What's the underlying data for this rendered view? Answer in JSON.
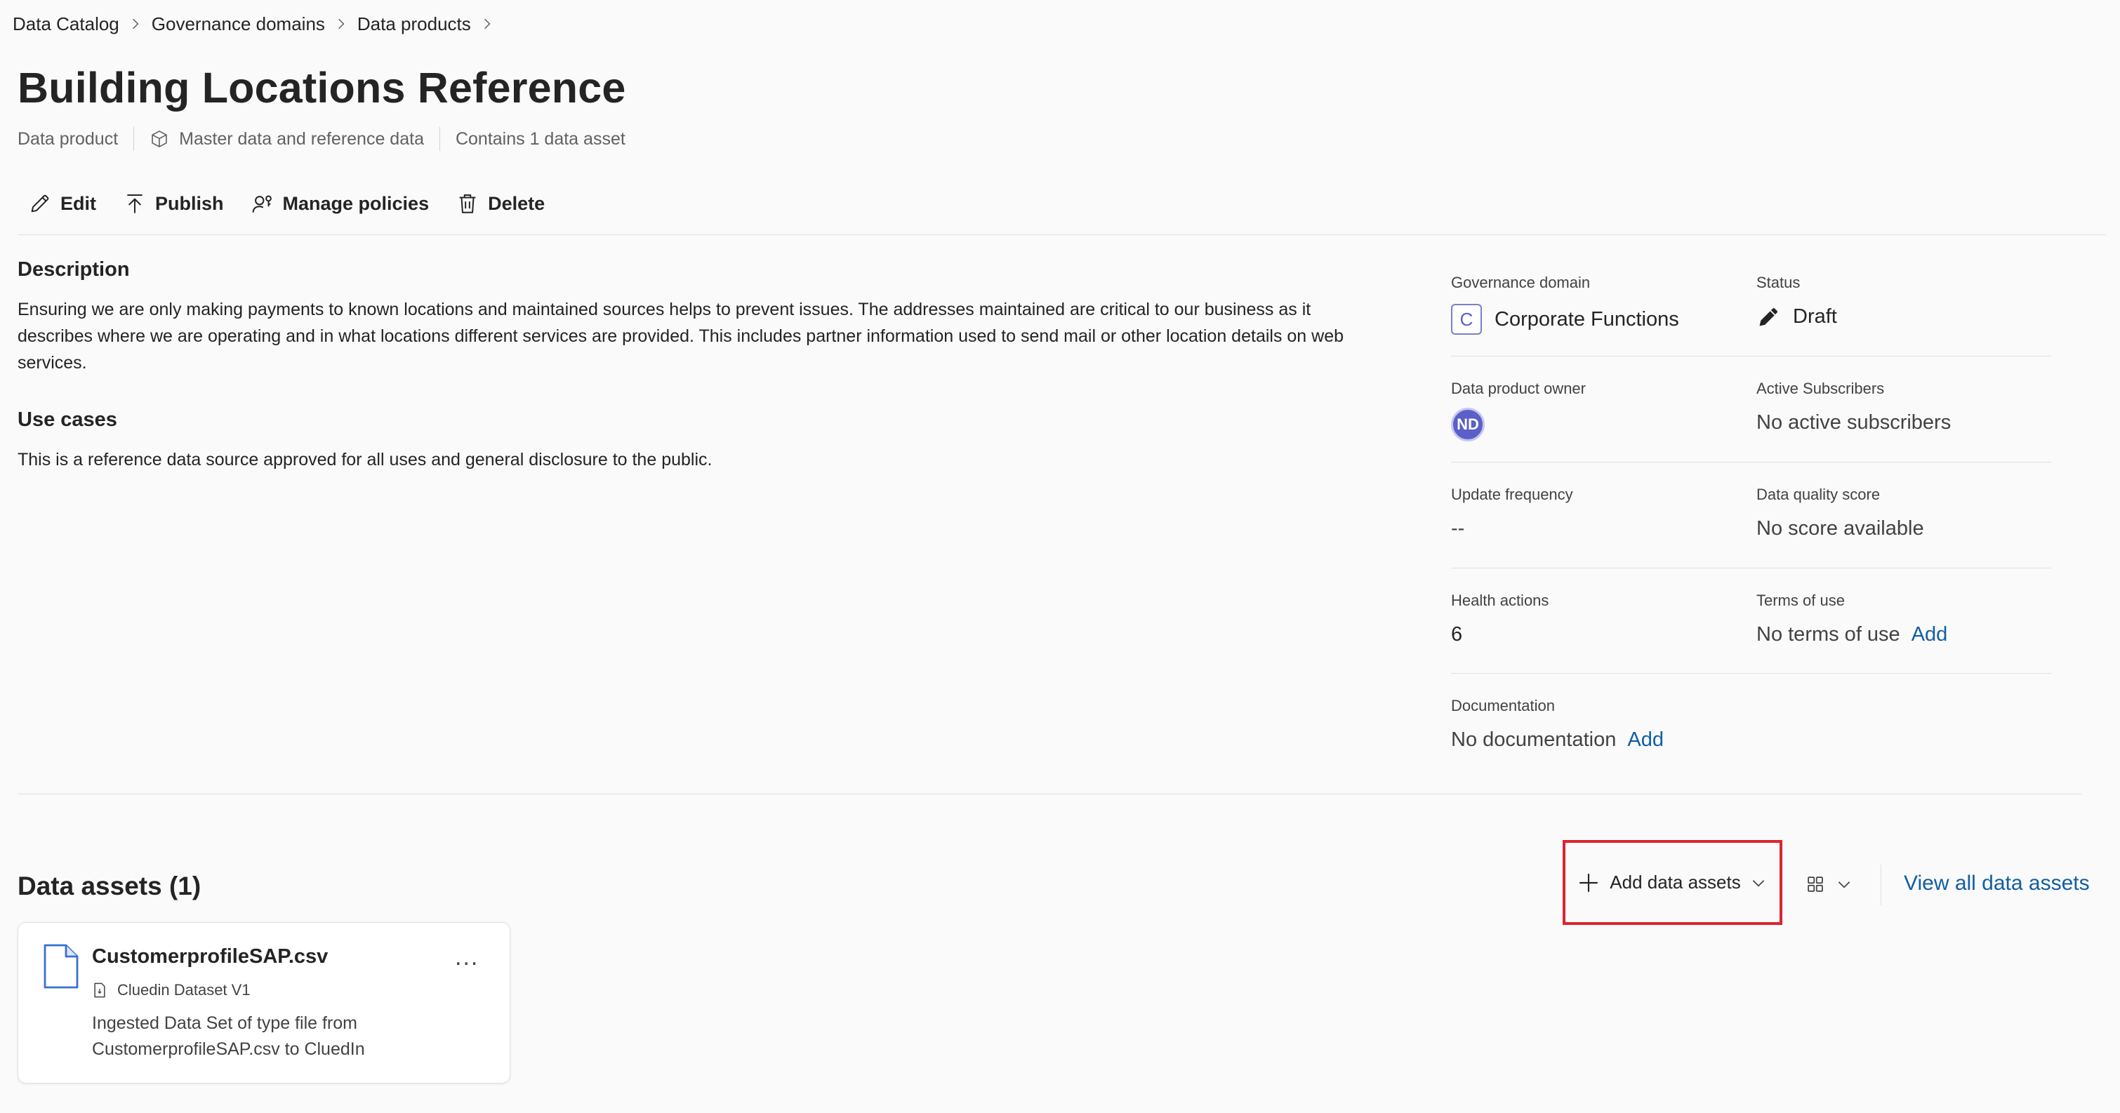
{
  "breadcrumb": {
    "items": [
      "Data Catalog",
      "Governance domains",
      "Data products"
    ]
  },
  "page": {
    "title": "Building Locations Reference",
    "type_label": "Data product",
    "category": "Master data and reference data",
    "asset_count_text": "Contains 1 data asset"
  },
  "toolbar": {
    "edit": "Edit",
    "publish": "Publish",
    "manage_policies": "Manage policies",
    "delete": "Delete"
  },
  "description": {
    "heading": "Description",
    "text": "Ensuring we are only making payments to known locations and maintained sources helps to prevent issues.  The addresses maintained are critical to our business as it describes where we are operating and in what locations different services are provided.  This includes partner information used to send mail or other location details on web services."
  },
  "use_cases": {
    "heading": "Use cases",
    "text": "This is a reference data source approved for all uses and general disclosure to the public."
  },
  "properties": {
    "governance_domain_label": "Governance domain",
    "governance_domain_badge": "C",
    "governance_domain_value": "Corporate Functions",
    "status_label": "Status",
    "status_value": "Draft",
    "owner_label": "Data product owner",
    "owner_initials": "ND",
    "subscribers_label": "Active Subscribers",
    "subscribers_value": "No active subscribers",
    "update_freq_label": "Update frequency",
    "update_freq_value": "--",
    "dq_label": "Data quality score",
    "dq_value": "No score available",
    "health_label": "Health actions",
    "health_value": "6",
    "terms_label": "Terms of use",
    "terms_value": "No terms of use",
    "terms_add": "Add",
    "docs_label": "Documentation",
    "docs_value": "No documentation",
    "docs_add": "Add"
  },
  "assets": {
    "title": "Data assets (1)",
    "add_button": "Add data assets",
    "view_all": "View all data assets",
    "items": [
      {
        "name": "CustomerprofileSAP.csv",
        "type": "Cluedin Dataset V1",
        "description": "Ingested Data Set of type file from CustomerprofileSAP.csv to CluedIn",
        "more": "..."
      }
    ]
  },
  "colors": {
    "accent_link": "#115ea3",
    "highlight_border": "#d9252f",
    "avatar_bg": "#5b5fc7"
  }
}
